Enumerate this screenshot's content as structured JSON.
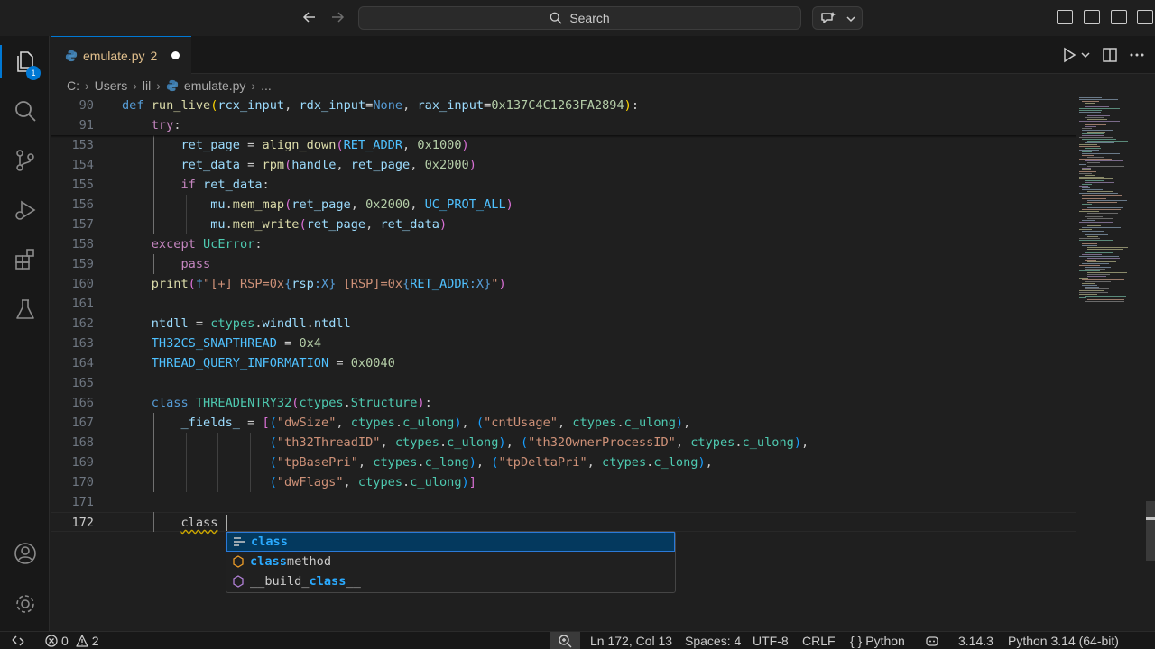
{
  "titlebar": {
    "search_label": "Search",
    "back_icon": "arrow-left-icon",
    "forward_icon": "arrow-right-icon"
  },
  "activity_bar": {
    "explorer_badge": "1",
    "items": [
      "explorer",
      "search",
      "source-control",
      "run-and-debug",
      "extensions",
      "testing"
    ],
    "bottom_items": [
      "accounts",
      "manage"
    ]
  },
  "tab": {
    "filename": "emulate.py",
    "problem_count": "2"
  },
  "breadcrumb": {
    "parts": [
      "C:",
      "Users",
      "lil",
      "emulate.py",
      "..."
    ]
  },
  "editor": {
    "lines": [
      {
        "n": "90",
        "indent": 0,
        "tokens": [
          [
            "df",
            "def "
          ],
          [
            "fn",
            "run_live"
          ],
          [
            "pn",
            "("
          ],
          [
            "vr",
            "rcx_input"
          ],
          [
            "t",
            ", "
          ],
          [
            "vr",
            "rdx_input"
          ],
          [
            "t",
            "="
          ],
          [
            "df",
            "None"
          ],
          [
            "t",
            ", "
          ],
          [
            "vr",
            "rax_input"
          ],
          [
            "t",
            "="
          ],
          [
            "nm",
            "0x137C4C1263FA2894"
          ],
          [
            "pn",
            ")"
          ],
          [
            "t",
            ":"
          ]
        ]
      },
      {
        "n": "91",
        "indent": 1,
        "tokens": [
          [
            "kw",
            "try"
          ],
          [
            "t",
            ":"
          ]
        ]
      },
      {
        "n": "153",
        "indent": 2,
        "tokens": [
          [
            "vr",
            "ret_page"
          ],
          [
            "t",
            " = "
          ],
          [
            "fn",
            "align_down"
          ],
          [
            "pp",
            "("
          ],
          [
            "cn",
            "RET_ADDR"
          ],
          [
            "t",
            ", "
          ],
          [
            "nm",
            "0x1000"
          ],
          [
            "pp",
            ")"
          ]
        ]
      },
      {
        "n": "154",
        "indent": 2,
        "tokens": [
          [
            "vr",
            "ret_data"
          ],
          [
            "t",
            " = "
          ],
          [
            "fn",
            "rpm"
          ],
          [
            "pp",
            "("
          ],
          [
            "vr",
            "handle"
          ],
          [
            "t",
            ", "
          ],
          [
            "vr",
            "ret_page"
          ],
          [
            "t",
            ", "
          ],
          [
            "nm",
            "0x2000"
          ],
          [
            "pp",
            ")"
          ]
        ]
      },
      {
        "n": "155",
        "indent": 2,
        "tokens": [
          [
            "kw",
            "if"
          ],
          [
            "t",
            " "
          ],
          [
            "vr",
            "ret_data"
          ],
          [
            "t",
            ":"
          ]
        ]
      },
      {
        "n": "156",
        "indent": 3,
        "tokens": [
          [
            "vr",
            "mu"
          ],
          [
            "t",
            "."
          ],
          [
            "fn",
            "mem_map"
          ],
          [
            "pp",
            "("
          ],
          [
            "vr",
            "ret_page"
          ],
          [
            "t",
            ", "
          ],
          [
            "nm",
            "0x2000"
          ],
          [
            "t",
            ", "
          ],
          [
            "cn",
            "UC_PROT_ALL"
          ],
          [
            "pp",
            ")"
          ]
        ]
      },
      {
        "n": "157",
        "indent": 3,
        "tokens": [
          [
            "vr",
            "mu"
          ],
          [
            "t",
            "."
          ],
          [
            "fn",
            "mem_write"
          ],
          [
            "pp",
            "("
          ],
          [
            "vr",
            "ret_page"
          ],
          [
            "t",
            ", "
          ],
          [
            "vr",
            "ret_data"
          ],
          [
            "pp",
            ")"
          ]
        ]
      },
      {
        "n": "158",
        "indent": 1,
        "tokens": [
          [
            "kw",
            "except"
          ],
          [
            "t",
            " "
          ],
          [
            "cl",
            "UcError"
          ],
          [
            "t",
            ":"
          ]
        ]
      },
      {
        "n": "159",
        "indent": 2,
        "tokens": [
          [
            "kw",
            "pass"
          ]
        ]
      },
      {
        "n": "160",
        "indent": 1,
        "tokens": [
          [
            "fn",
            "print"
          ],
          [
            "pp",
            "("
          ],
          [
            "df",
            "f"
          ],
          [
            "st",
            "\"[+] RSP=0x"
          ],
          [
            "df",
            "{"
          ],
          [
            "vr",
            "rsp"
          ],
          [
            "df",
            ":X}"
          ],
          [
            "st",
            " [RSP]=0x"
          ],
          [
            "df",
            "{"
          ],
          [
            "cn",
            "RET_ADDR"
          ],
          [
            "df",
            ":X}"
          ],
          [
            "st",
            "\""
          ],
          [
            "pp",
            ")"
          ]
        ]
      },
      {
        "n": "161",
        "indent": 0,
        "tokens": []
      },
      {
        "n": "162",
        "indent": 1,
        "tokens": [
          [
            "vr",
            "ntdll"
          ],
          [
            "t",
            " = "
          ],
          [
            "cl",
            "ctypes"
          ],
          [
            "t",
            "."
          ],
          [
            "vr",
            "windll"
          ],
          [
            "t",
            "."
          ],
          [
            "vr",
            "ntdll"
          ]
        ]
      },
      {
        "n": "163",
        "indent": 1,
        "tokens": [
          [
            "cn",
            "TH32CS_SNAPTHREAD"
          ],
          [
            "t",
            " = "
          ],
          [
            "nm",
            "0x4"
          ]
        ]
      },
      {
        "n": "164",
        "indent": 1,
        "tokens": [
          [
            "cn",
            "THREAD_QUERY_INFORMATION"
          ],
          [
            "t",
            " = "
          ],
          [
            "nm",
            "0x0040"
          ]
        ]
      },
      {
        "n": "165",
        "indent": 0,
        "tokens": []
      },
      {
        "n": "166",
        "indent": 1,
        "tokens": [
          [
            "df",
            "class "
          ],
          [
            "cl",
            "THREADENTRY32"
          ],
          [
            "pp",
            "("
          ],
          [
            "cl",
            "ctypes"
          ],
          [
            "t",
            "."
          ],
          [
            "cl",
            "Structure"
          ],
          [
            "pp",
            ")"
          ],
          [
            "t",
            ":"
          ]
        ]
      },
      {
        "n": "167",
        "indent": 2,
        "tokens": [
          [
            "vr",
            "_fields_"
          ],
          [
            "t",
            " = "
          ],
          [
            "pp",
            "["
          ],
          [
            "pb",
            "("
          ],
          [
            "st",
            "\"dwSize\""
          ],
          [
            "t",
            ", "
          ],
          [
            "cl",
            "ctypes"
          ],
          [
            "t",
            "."
          ],
          [
            "cl",
            "c_ulong"
          ],
          [
            "pb",
            ")"
          ],
          [
            "t",
            ", "
          ],
          [
            "pb",
            "("
          ],
          [
            "st",
            "\"cntUsage\""
          ],
          [
            "t",
            ", "
          ],
          [
            "cl",
            "ctypes"
          ],
          [
            "t",
            "."
          ],
          [
            "cl",
            "c_ulong"
          ],
          [
            "pb",
            ")"
          ],
          [
            "t",
            ","
          ]
        ]
      },
      {
        "n": "168",
        "indent": 2,
        "pad": "            ",
        "tokens": [
          [
            "pb",
            "("
          ],
          [
            "st",
            "\"th32ThreadID\""
          ],
          [
            "t",
            ", "
          ],
          [
            "cl",
            "ctypes"
          ],
          [
            "t",
            "."
          ],
          [
            "cl",
            "c_ulong"
          ],
          [
            "pb",
            ")"
          ],
          [
            "t",
            ", "
          ],
          [
            "pb",
            "("
          ],
          [
            "st",
            "\"th32OwnerProcessID\""
          ],
          [
            "t",
            ", "
          ],
          [
            "cl",
            "ctypes"
          ],
          [
            "t",
            "."
          ],
          [
            "cl",
            "c_ulong"
          ],
          [
            "pb",
            ")"
          ],
          [
            "t",
            ","
          ]
        ]
      },
      {
        "n": "169",
        "indent": 2,
        "pad": "            ",
        "tokens": [
          [
            "pb",
            "("
          ],
          [
            "st",
            "\"tpBasePri\""
          ],
          [
            "t",
            ", "
          ],
          [
            "cl",
            "ctypes"
          ],
          [
            "t",
            "."
          ],
          [
            "cl",
            "c_long"
          ],
          [
            "pb",
            ")"
          ],
          [
            "t",
            ", "
          ],
          [
            "pb",
            "("
          ],
          [
            "st",
            "\"tpDeltaPri\""
          ],
          [
            "t",
            ", "
          ],
          [
            "cl",
            "ctypes"
          ],
          [
            "t",
            "."
          ],
          [
            "cl",
            "c_long"
          ],
          [
            "pb",
            ")"
          ],
          [
            "t",
            ","
          ]
        ]
      },
      {
        "n": "170",
        "indent": 2,
        "pad": "            ",
        "tokens": [
          [
            "pb",
            "("
          ],
          [
            "st",
            "\"dwFlags\""
          ],
          [
            "t",
            ", "
          ],
          [
            "cl",
            "ctypes"
          ],
          [
            "t",
            "."
          ],
          [
            "cl",
            "c_ulong"
          ],
          [
            "pb",
            ")"
          ],
          [
            "pp",
            "]"
          ]
        ]
      },
      {
        "n": "171",
        "indent": 0,
        "tokens": []
      },
      {
        "n": "172",
        "indent": 2,
        "current": true,
        "tokens": [
          [
            "sq",
            "class"
          ]
        ]
      }
    ]
  },
  "suggest": {
    "items": [
      {
        "icon": "keyword-icon",
        "match": "class",
        "rest": "",
        "prefix": ""
      },
      {
        "icon": "method-icon",
        "match": "class",
        "rest": "method",
        "prefix": ""
      },
      {
        "icon": "variable-icon",
        "match": "class",
        "rest": "__",
        "prefix": "__build_"
      }
    ]
  },
  "statusbar": {
    "errors": "0",
    "warnings": "2",
    "position": "Ln 172, Col 13",
    "spaces": "Spaces: 4",
    "encoding": "UTF-8",
    "eol": "CRLF",
    "language": "Python",
    "python_version": "3.14.3",
    "interpreter": "Python 3.14 (64-bit)"
  },
  "colors": {
    "accent": "#0078d4",
    "editor_bg": "#1f1f1f",
    "keyword": "#c586c0",
    "function": "#dcdcaa",
    "string": "#ce9178",
    "number": "#b5cea8",
    "class": "#4ec9b0"
  }
}
